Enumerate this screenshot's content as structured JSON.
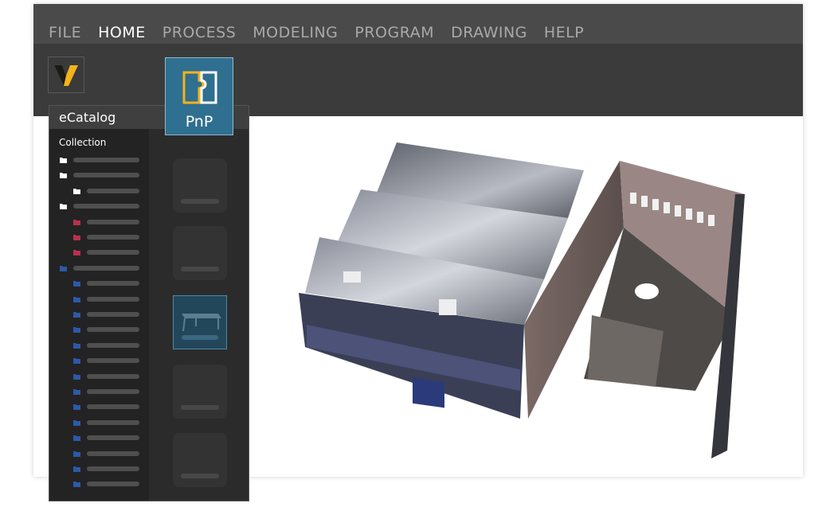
{
  "menu": {
    "items": [
      {
        "label": "FILE",
        "active": false
      },
      {
        "label": "HOME",
        "active": true
      },
      {
        "label": "PROCESS",
        "active": false
      },
      {
        "label": "MODELING",
        "active": false
      },
      {
        "label": "PROGRAM",
        "active": false
      },
      {
        "label": "DRAWING",
        "active": false
      },
      {
        "label": "HELP",
        "active": false
      }
    ]
  },
  "ribbon": {
    "pnp_label": "PnP"
  },
  "ecatalog": {
    "title": "eCatalog",
    "collection_label": "Collection",
    "folder_colors": {
      "default": "#ffffff",
      "red": "#b8304f",
      "blue": "#2c5aa8"
    }
  },
  "colors": {
    "topbar": "#3b3b3b",
    "menubar": "#4a4a4a",
    "accent_blue": "#2f6f90",
    "logo_yellow": "#f3b31b"
  }
}
